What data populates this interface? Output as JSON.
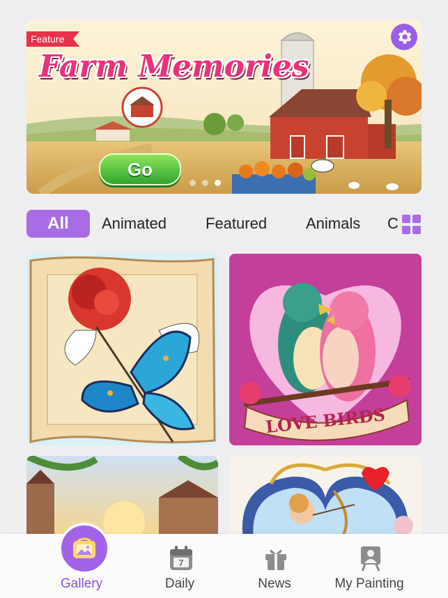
{
  "banner": {
    "tag": "Feature",
    "title": "Farm Memories",
    "button_label": "Go",
    "settings_icon": "gear-icon",
    "pager_count": 3,
    "pager_active": 3
  },
  "categories": {
    "items": [
      "All",
      "Animated",
      "Featured",
      "Animals",
      "C"
    ],
    "active": "All",
    "view_toggle_icon": "grid-view-icon"
  },
  "gallery": {
    "cards": [
      {
        "subject": "rose-and-butterfly"
      },
      {
        "subject": "love-birds",
        "caption": "LOVE BIRDS"
      },
      {
        "subject": "village-sunset"
      },
      {
        "subject": "cupid-heart"
      }
    ]
  },
  "bottom_nav": {
    "items": [
      {
        "label": "Gallery",
        "icon": "gallery-icon",
        "active": true
      },
      {
        "label": "Daily",
        "icon": "calendar-icon",
        "date": "7"
      },
      {
        "label": "News",
        "icon": "gift-icon"
      },
      {
        "label": "My Painting",
        "icon": "easel-icon"
      }
    ]
  },
  "colors": {
    "accent": "#a86ce6",
    "feature_tag": "#e8314a",
    "title_pink": "#e9327a",
    "go_green": "#3fb533"
  }
}
